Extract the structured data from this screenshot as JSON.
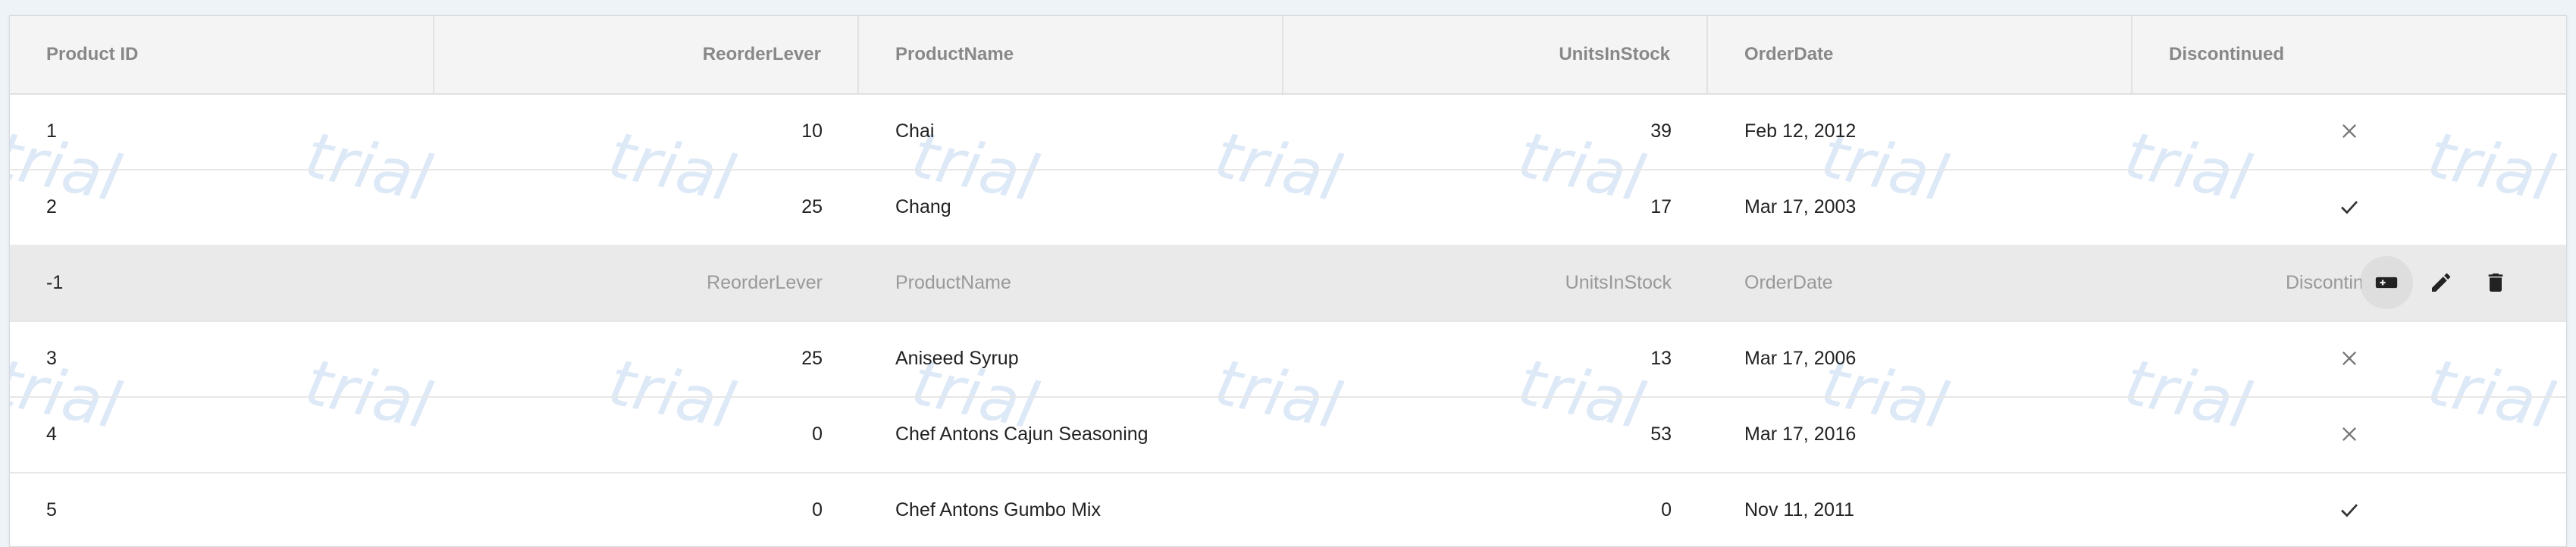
{
  "grid": {
    "columns": [
      "Product ID",
      "ReorderLever",
      "ProductName",
      "UnitsInStock",
      "OrderDate",
      "Discontinued"
    ],
    "rows": [
      {
        "id": "1",
        "reorder": "10",
        "name": "Chai",
        "stock": "39",
        "date": "Feb 12, 2012",
        "discontinued": false
      },
      {
        "id": "2",
        "reorder": "25",
        "name": "Chang",
        "stock": "17",
        "date": "Mar 17, 2003",
        "discontinued": true
      },
      {
        "id": "3",
        "reorder": "25",
        "name": "Aniseed Syrup",
        "stock": "13",
        "date": "Mar 17, 2006",
        "discontinued": false
      },
      {
        "id": "4",
        "reorder": "0",
        "name": "Chef Antons Cajun Seasoning",
        "stock": "53",
        "date": "Mar 17, 2016",
        "discontinued": false
      },
      {
        "id": "5",
        "reorder": "0",
        "name": "Chef Antons Gumbo Mix",
        "stock": "0",
        "date": "Nov 11, 2011",
        "discontinued": true
      }
    ],
    "add_row": {
      "id": "-1",
      "reorder_placeholder": "ReorderLever",
      "name_placeholder": "ProductName",
      "stock_placeholder": "UnitsInStock",
      "date_placeholder": "OrderDate",
      "discontinued_placeholder": "Discontinued"
    },
    "actions": [
      "add-row-icon",
      "pencil-icon",
      "trash-icon"
    ]
  },
  "watermark": "trial",
  "colors": {
    "header_bg": "#f4f4f4",
    "edit_row_bg": "#eaeaea",
    "watermark": "#dde9f7"
  }
}
